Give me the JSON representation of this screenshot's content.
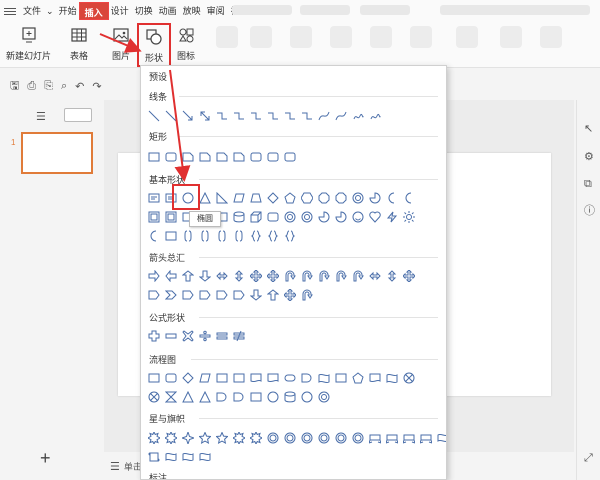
{
  "menubar": {
    "items": [
      "文件",
      "开始",
      "插入",
      "设计",
      "切换",
      "动画",
      "放映",
      "审阅",
      "视图"
    ]
  },
  "ribbon": {
    "new_slide": "新建幻灯片",
    "table": "表格",
    "picture": "图片",
    "shapes": "形状",
    "icons": "图标"
  },
  "shapes_menu": {
    "sections": [
      "预设",
      "线条",
      "矩形",
      "基本形状",
      "箭头总汇",
      "公式形状",
      "流程图",
      "星与旗帜",
      "标注"
    ],
    "tooltip": "椭圆"
  },
  "statusbar": {
    "label": "单击"
  },
  "left_panel": {
    "slide_number": "1",
    "add_slide": "+"
  },
  "colors": {
    "accent": "#d9463b",
    "highlight": "#e03030",
    "shape_stroke": "#4a6ea9",
    "thumb_border": "#e07b39"
  }
}
